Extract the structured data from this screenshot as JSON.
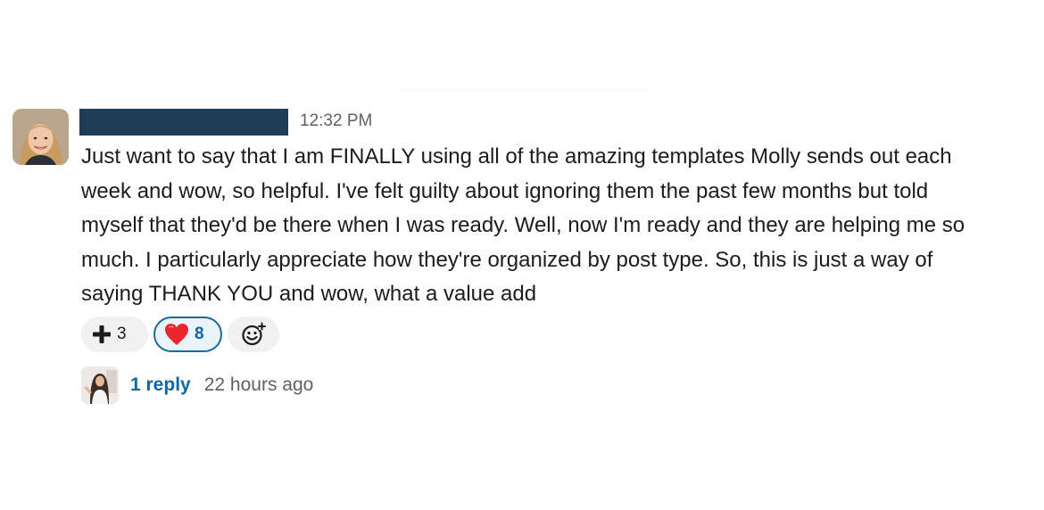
{
  "message": {
    "timestamp": "12:32 PM",
    "author_name_redacted": true,
    "lines": [
      "Just want to say that I am FINALLY using all of the amazing templates Molly sends out each",
      "week and wow, so helpful. I've felt guilty about ignoring them the past few months but told",
      "myself that they'd be there when I was ready. Well, now I'm ready and they are helping me so",
      "much. I particularly appreciate how they're organized by post type. So, this is just a way of",
      "saying THANK YOU and wow, what a value add"
    ]
  },
  "reactions": [
    {
      "icon": "plus-icon",
      "count": "3",
      "reacted": false
    },
    {
      "icon": "red-heart-icon",
      "count": "8",
      "reacted": true
    }
  ],
  "add_reaction_icon": "add-emoji-icon",
  "thread": {
    "reply_label": "1 reply",
    "reply_time": "22 hours ago"
  },
  "colors": {
    "link": "#1264a3",
    "redaction_bar": "#1e3e58",
    "reacted_border": "#1d6a98",
    "reacted_bg": "#e8f4fa",
    "heart": "#e8262c"
  }
}
